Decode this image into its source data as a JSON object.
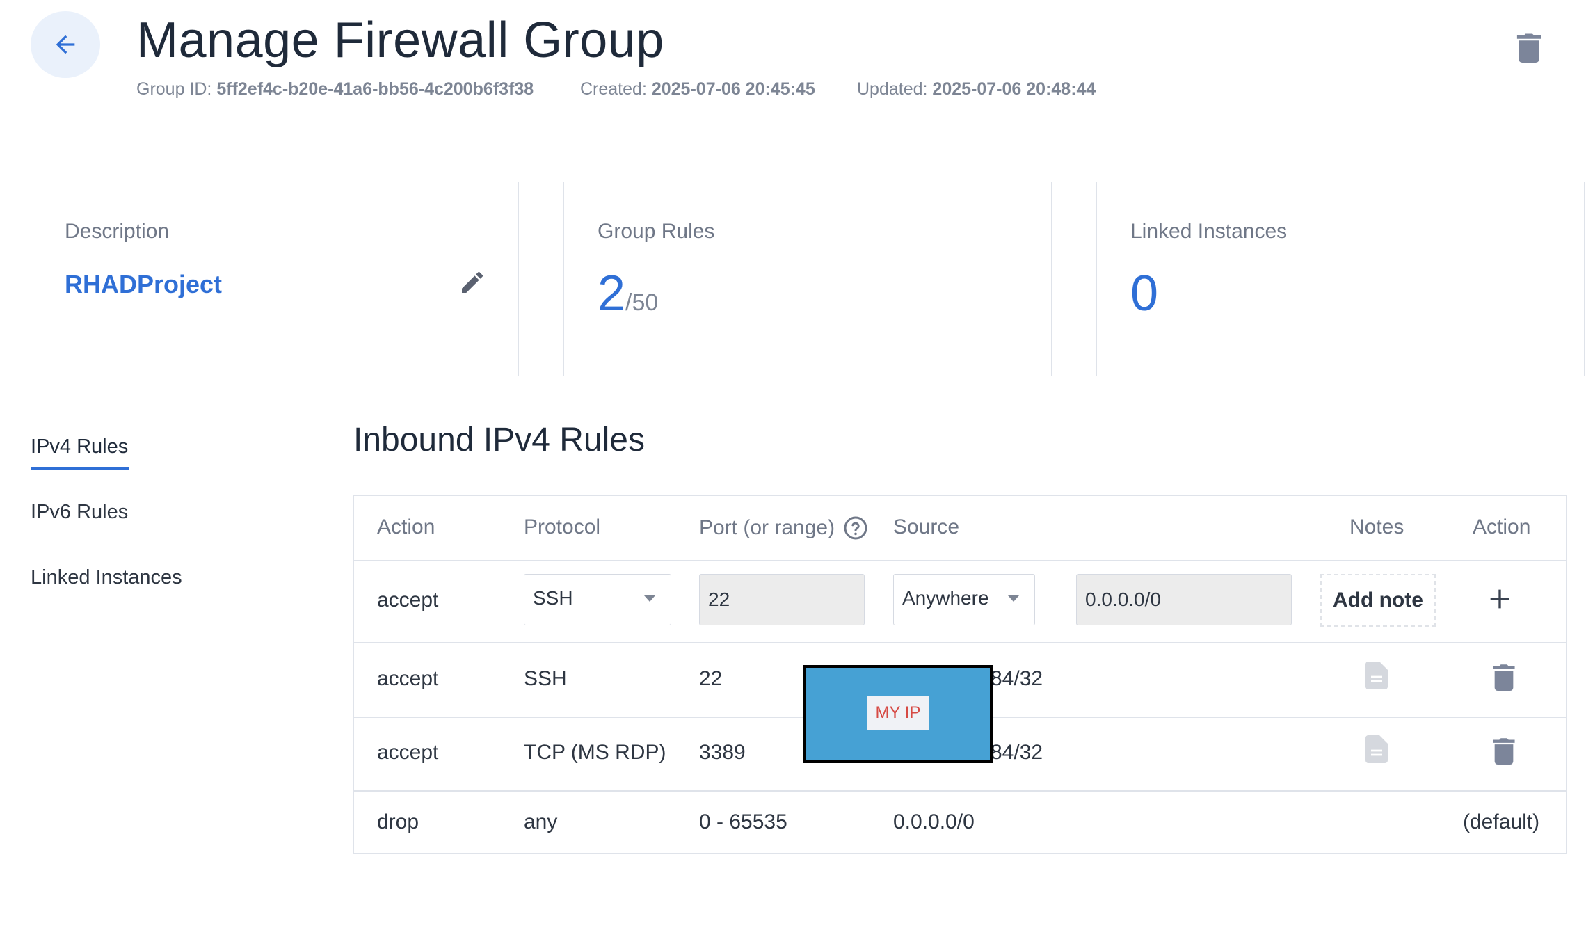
{
  "header": {
    "title": "Manage Firewall Group",
    "group_id_label": "Group ID:",
    "group_id": "5ff2ef4c-b20e-41a6-bb56-4c200b6f3f38",
    "created_label": "Created:",
    "created": "2025-07-06 20:45:45",
    "updated_label": "Updated:",
    "updated": "2025-07-06 20:48:44"
  },
  "cards": {
    "description_label": "Description",
    "description_value": "RHADProject",
    "group_rules_label": "Group Rules",
    "group_rules_count": "2",
    "group_rules_max": "/50",
    "linked_instances_label": "Linked Instances",
    "linked_instances_count": "0"
  },
  "nav": {
    "items": [
      "IPv4 Rules",
      "IPv6 Rules",
      "Linked Instances"
    ],
    "active": "IPv4 Rules"
  },
  "section_title": "Inbound IPv4 Rules",
  "table": {
    "headers": [
      "Action",
      "Protocol",
      "Port (or range)",
      "Source",
      "Notes",
      "Action"
    ],
    "new_rule": {
      "action": "accept",
      "protocol": "SSH",
      "port": "22",
      "source": "Anywhere",
      "cidr": "0.0.0.0/0",
      "add_note_label": "Add note"
    },
    "rows": [
      {
        "action": "accept",
        "protocol": "SSH",
        "port": "22",
        "source_suffix": "84/32"
      },
      {
        "action": "accept",
        "protocol": "TCP (MS RDP)",
        "port": "3389",
        "source_suffix": "84/32"
      },
      {
        "action": "drop",
        "protocol": "any",
        "port": "0 - 65535",
        "source": "0.0.0.0/0",
        "note": "(default)"
      }
    ]
  },
  "redaction_label": "MY IP",
  "colors": {
    "accent": "#2f6fd6",
    "back_button_bg": "#eaf1fb",
    "redaction_fill": "#46a1d4",
    "redaction_text": "#d64a44",
    "icon_gray": "#7c859a"
  },
  "icons": [
    "back-arrow-icon",
    "trash-icon",
    "pencil-icon",
    "help-circle-icon",
    "chevron-down-icon",
    "plus-icon",
    "document-icon"
  ]
}
